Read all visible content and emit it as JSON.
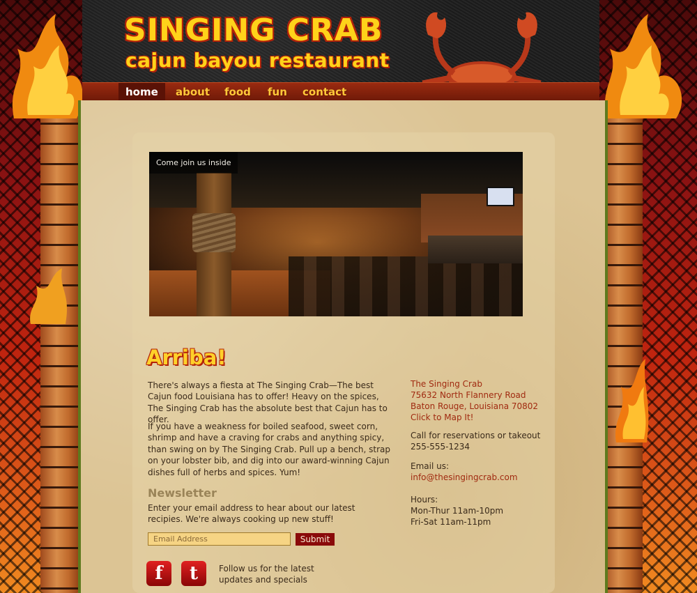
{
  "header": {
    "title": "SINGING CRAB",
    "subtitle": "cajun bayou restaurant"
  },
  "nav": {
    "items": [
      {
        "label": "home"
      },
      {
        "label": "about"
      },
      {
        "label": "food"
      },
      {
        "label": "fun"
      },
      {
        "label": "contact"
      }
    ],
    "active": "home"
  },
  "slideshow": {
    "caption": "Come join us inside"
  },
  "intro": {
    "heading": "Arriba!",
    "paragraph1": "There's always a fiesta at The Singing Crab—The best Cajun food Louisiana has to offer! Heavy on the spices, The Singing Crab has the absolute best that Cajun has to offer.",
    "paragraph2": "If you have a weakness for boiled seafood, sweet corn, shrimp and have a craving for crabs and anything spicy, than swing on by The Singing Crab. Pull up a bench, strap on your lobster bib, and dig into our award-winning Cajun dishes full of herbs and spices. Yum!"
  },
  "newsletter": {
    "title": "Newsletter",
    "text": "Enter your email address to hear about our latest recipies. We're always cooking up new stuff!",
    "email_placeholder": "Email Address",
    "submit_label": "Submit"
  },
  "social": {
    "facebook_glyph": "f",
    "twitter_glyph": "t",
    "follow_text": "Follow us for the latest updates and specials"
  },
  "contact": {
    "name": "The Singing Crab",
    "street": "75632 North Flannery Road",
    "city": "Baton Rouge, Louisiana 70802",
    "map_link": "Click to Map It!",
    "phone_label": "Call for reservations or takeout",
    "phone": "255-555-1234",
    "email_label": "Email us:",
    "email": "info@thesingingcrab.com",
    "hours_label": "Hours:",
    "hours_weekday": "Mon-Thur 11am-10pm",
    "hours_weekend": "Fri-Sat 11am-11pm"
  },
  "colors": {
    "accent": "#ffd21a",
    "link": "#a02a10",
    "nav_bar": "#7a1e0a",
    "border_green": "#5e7a1e",
    "button": "#8a0a0a"
  }
}
